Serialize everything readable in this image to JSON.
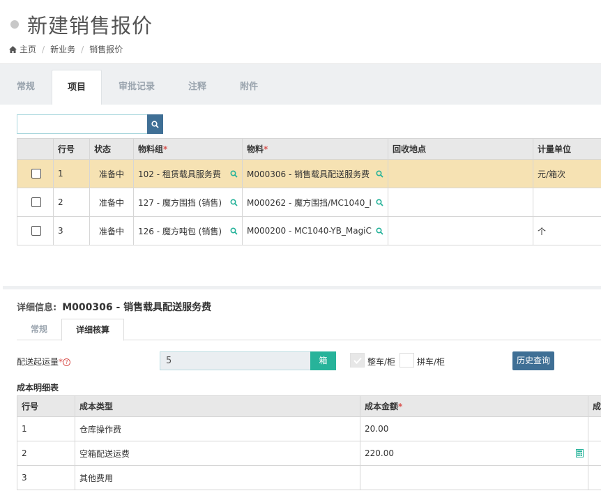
{
  "header": {
    "title": "新建销售报价",
    "breadcrumb": [
      "主页",
      "新业务",
      "销售报价"
    ]
  },
  "tabs": [
    "常规",
    "项目",
    "审批记录",
    "注释",
    "附件"
  ],
  "active_tab": "项目",
  "search": {
    "value": ""
  },
  "items_table": {
    "columns": [
      "",
      "行号",
      "状态",
      "物料组",
      "物料",
      "回收地点",
      "计量单位"
    ],
    "required_mark": "*",
    "rows": [
      {
        "line": "1",
        "status": "准备中",
        "group": "102 - 租赁载具服务费",
        "material": "M000306 - 销售载具配送服务费",
        "location": "",
        "unit": "元/箱次",
        "selected": true
      },
      {
        "line": "2",
        "status": "准备中",
        "group": "127 - 魔方围挡 (销售)",
        "material": "M000262 - 魔方围挡/MC1040_I",
        "location": "",
        "unit": "",
        "selected": false
      },
      {
        "line": "3",
        "status": "准备中",
        "group": "126 - 魔方吨包 (销售)",
        "material": "M000200 - MC1040-YB_MagiC",
        "location": "",
        "unit": "个",
        "selected": false
      }
    ]
  },
  "detail": {
    "label": "详细信息:",
    "value": "M000306 - 销售载具配送服务费",
    "subtabs": [
      "常规",
      "详细核算"
    ],
    "active_subtab": "详细核算",
    "start_qty_label": "配送起运量",
    "start_qty_value": "5",
    "start_qty_unit": "箱",
    "option_full": "整车/柜",
    "option_full_checked": true,
    "option_partial": "拼车/柜",
    "option_partial_checked": false,
    "history_button": "历史查询"
  },
  "cost_table": {
    "title": "成本明细表",
    "columns": [
      "行号",
      "成本类型",
      "成本金额",
      "成本"
    ],
    "rows": [
      {
        "line": "1",
        "type": "仓库操作费",
        "amount": "20.00"
      },
      {
        "line": "2",
        "type": "空箱配送运费",
        "amount": "220.00"
      },
      {
        "line": "3",
        "type": "其他费用",
        "amount": ""
      }
    ]
  },
  "colors": {
    "primary": "#3f6f95",
    "accent": "#27b39a",
    "selected_row": "#f6e2b3",
    "required": "#d9534f"
  }
}
